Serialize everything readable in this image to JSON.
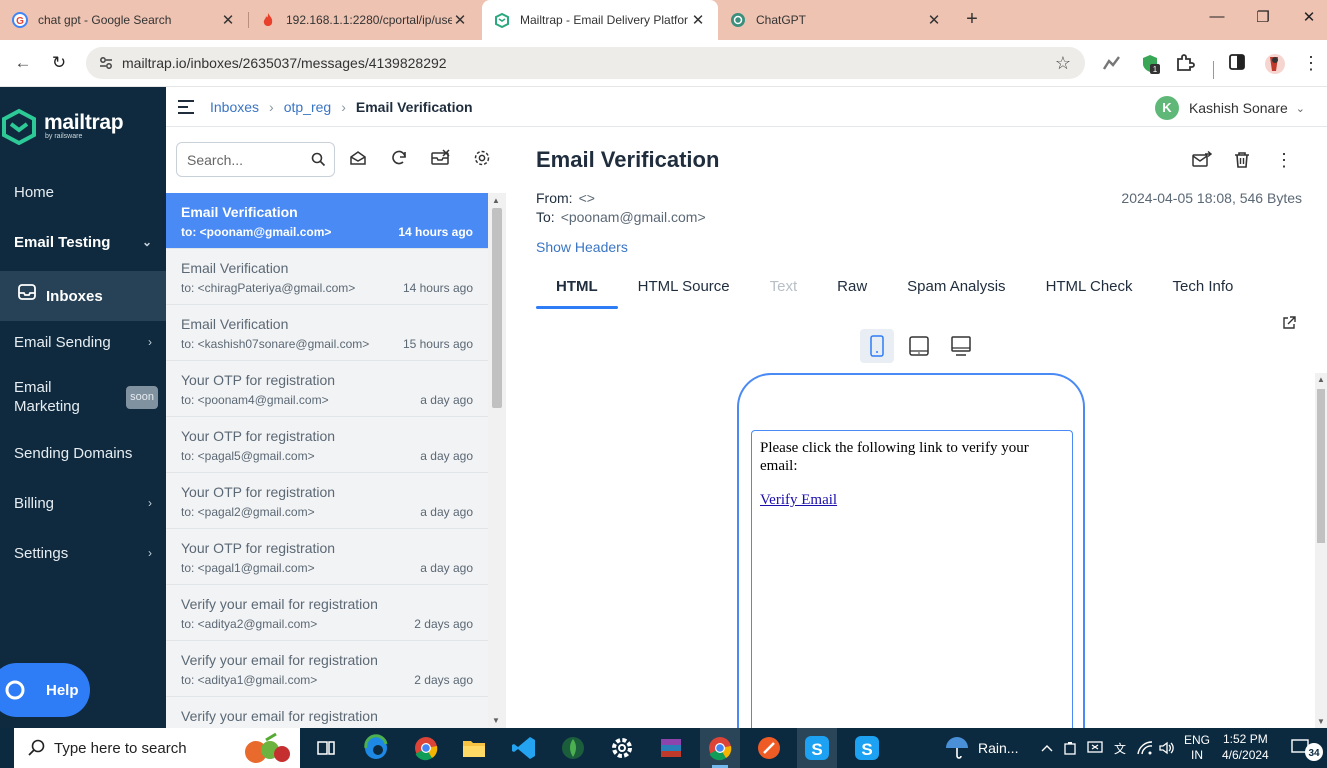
{
  "browser": {
    "tabs": [
      {
        "title": "chat gpt - Google Search",
        "icon": "google-icon",
        "active": false
      },
      {
        "title": "192.168.1.1:2280/cportal/ip/use",
        "icon": "fire-icon",
        "active": false
      },
      {
        "title": "Mailtrap - Email Delivery Platfor",
        "icon": "mailtrap-icon",
        "active": true
      },
      {
        "title": "ChatGPT",
        "icon": "chatgpt-icon",
        "active": false
      }
    ],
    "new_tab": "+",
    "url": "mailtrap.io/inboxes/2635037/messages/4139828292",
    "extension_badge": "1"
  },
  "sidebar": {
    "logo_text": "mailtrap",
    "logo_sub": "by railsware",
    "items": [
      {
        "label": "Home"
      },
      {
        "label": "Email Testing"
      },
      {
        "label": "Inboxes"
      },
      {
        "label": "Email Sending"
      },
      {
        "label": "Email\nMarketing",
        "badge": "soon"
      },
      {
        "label": "Sending Domains"
      },
      {
        "label": "Billing"
      },
      {
        "label": "Settings"
      }
    ],
    "help": "Help"
  },
  "header": {
    "breadcrumbs": [
      "Inboxes",
      "otp_reg",
      "Email Verification"
    ],
    "user_initial": "K",
    "user_name": "Kashish Sonare"
  },
  "list": {
    "search_placeholder": "Search...",
    "messages": [
      {
        "subject": "Email Verification",
        "to": "to: <poonam@gmail.com>",
        "time": "14 hours ago",
        "active": true
      },
      {
        "subject": "Email Verification",
        "to": "to: <chiragPateriya@gmail.com>",
        "time": "14 hours ago"
      },
      {
        "subject": "Email Verification",
        "to": "to: <kashish07sonare@gmail.com>",
        "time": "15 hours ago"
      },
      {
        "subject": "Your OTP for registration",
        "to": "to: <poonam4@gmail.com>",
        "time": "a day ago"
      },
      {
        "subject": "Your OTP for registration",
        "to": "to: <pagal5@gmail.com>",
        "time": "a day ago"
      },
      {
        "subject": "Your OTP for registration",
        "to": "to: <pagal2@gmail.com>",
        "time": "a day ago"
      },
      {
        "subject": "Your OTP for registration",
        "to": "to: <pagal1@gmail.com>",
        "time": "a day ago"
      },
      {
        "subject": "Verify your email for registration",
        "to": "to: <aditya2@gmail.com>",
        "time": "2 days ago"
      },
      {
        "subject": "Verify your email for registration",
        "to": "to: <aditya1@gmail.com>",
        "time": "2 days ago"
      },
      {
        "subject": "Verify your email for registration",
        "to": "",
        "time": ""
      }
    ]
  },
  "detail": {
    "title": "Email Verification",
    "from_label": "From:",
    "from_value": "<>",
    "to_label": "To:",
    "to_value": "<poonam@gmail.com>",
    "date_size": "2024-04-05 18:08, 546 Bytes",
    "show_headers": "Show Headers",
    "tabs": [
      {
        "label": "HTML",
        "active": true
      },
      {
        "label": "HTML Source"
      },
      {
        "label": "Text",
        "disabled": true
      },
      {
        "label": "Raw"
      },
      {
        "label": "Spam Analysis"
      },
      {
        "label": "HTML Check"
      },
      {
        "label": "Tech Info"
      }
    ],
    "body_text": "Please click the following link to verify your email:",
    "body_link": "Verify Email"
  },
  "taskbar": {
    "search_placeholder": "Type here to search",
    "weather": "Rain...",
    "lang": "ENG",
    "region": "IN",
    "time": "1:52 PM",
    "date": "4/6/2024",
    "notifications": "34"
  },
  "colors": {
    "sidebar_bg": "#0f2a3e",
    "accent": "#2e7cf6",
    "active_row": "#4a8af4",
    "tabbar_bg": "#eec3b2"
  }
}
